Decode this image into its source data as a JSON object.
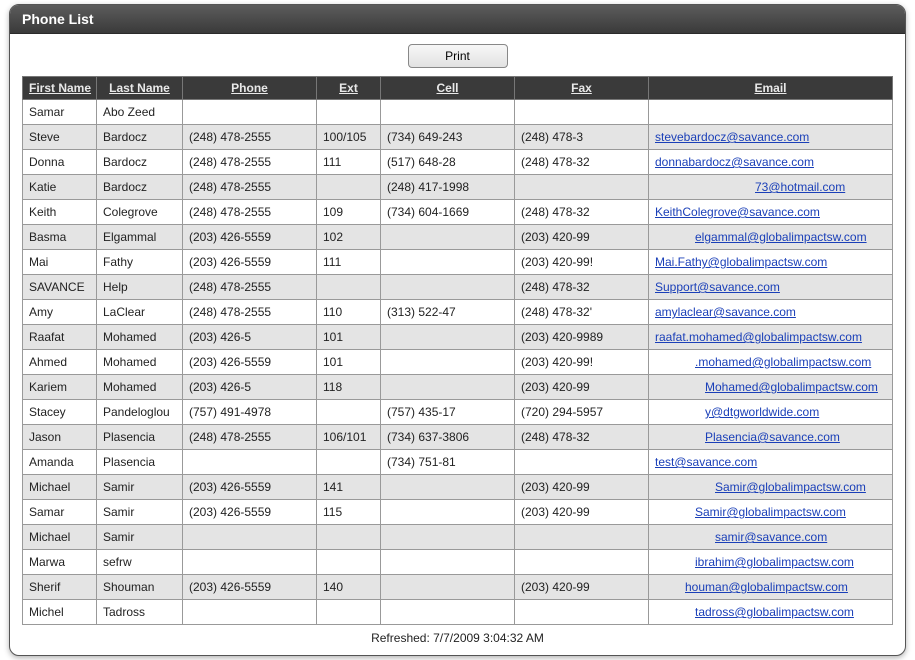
{
  "window": {
    "title": "Phone List"
  },
  "toolbar": {
    "print_label": "Print"
  },
  "columns": {
    "first": "First Name",
    "last": "Last Name",
    "phone": "Phone",
    "ext": "Ext",
    "cell": "Cell",
    "fax": "Fax",
    "email": "Email"
  },
  "footer": {
    "refreshed": "Refreshed: 7/7/2009 3:04:32 AM"
  },
  "rows": [
    {
      "first": "Samar",
      "last": "Abo Zeed",
      "phone": "",
      "ext": "",
      "cell": "",
      "fax": "",
      "email": "",
      "indent": 0
    },
    {
      "first": "Steve",
      "last": "Bardocz",
      "phone": "(248) 478-2555",
      "ext": "100/105",
      "cell": "(734) 649-243",
      "fax": "(248) 478-3",
      "email": "stevebardocz@savance.com",
      "indent": 0
    },
    {
      "first": "Donna",
      "last": "Bardocz",
      "phone": "(248) 478-2555",
      "ext": "111",
      "cell": "(517) 648-28",
      "fax": "(248) 478-32",
      "email": "donnabardocz@savance.com",
      "indent": 0
    },
    {
      "first": "Katie",
      "last": "Bardocz",
      "phone": "(248) 478-2555",
      "ext": "",
      "cell": "(248) 417-1998",
      "fax": "",
      "email": "73@hotmail.com",
      "indent": 100
    },
    {
      "first": "Keith",
      "last": "Colegrove",
      "phone": "(248) 478-2555",
      "ext": "109",
      "cell": "(734) 604-1669",
      "fax": "(248) 478-32",
      "email": "KeithColegrove@savance.com",
      "indent": 0
    },
    {
      "first": "Basma",
      "last": "Elgammal",
      "phone": "(203) 426-5559",
      "ext": "102",
      "cell": "",
      "fax": "(203) 420-99",
      "email": "elgammal@globalimpactsw.com",
      "indent": 40
    },
    {
      "first": "Mai",
      "last": "Fathy",
      "phone": "(203) 426-5559",
      "ext": "111",
      "cell": "",
      "fax": "(203) 420-99!",
      "email": "Mai.Fathy@globalimpactsw.com",
      "indent": 0
    },
    {
      "first": "SAVANCE",
      "last": "Help",
      "phone": "(248) 478-2555",
      "ext": "",
      "cell": "",
      "fax": "(248) 478-32",
      "email": "Support@savance.com",
      "indent": 0
    },
    {
      "first": "Amy",
      "last": "LaClear",
      "phone": "(248) 478-2555",
      "ext": "110",
      "cell": "(313) 522-47",
      "fax": "(248) 478-32'",
      "email": "amylaclear@savance.com",
      "indent": 0
    },
    {
      "first": "Raafat",
      "last": "Mohamed",
      "phone": "(203) 426-5",
      "ext": "101",
      "cell": "",
      "fax": "(203) 420-9989",
      "email": "raafat.mohamed@globalimpactsw.com",
      "indent": 0
    },
    {
      "first": "Ahmed",
      "last": "Mohamed",
      "phone": "(203) 426-5559",
      "ext": "101",
      "cell": "",
      "fax": "(203) 420-99!",
      "email": ".mohamed@globalimpactsw.com",
      "indent": 40
    },
    {
      "first": "Kariem",
      "last": "Mohamed",
      "phone": "(203) 426-5",
      "ext": "118",
      "cell": "",
      "fax": "(203) 420-99",
      "email": "Mohamed@globalimpactsw.com",
      "indent": 50
    },
    {
      "first": "Stacey",
      "last": "Pandeloglou",
      "phone": "(757) 491-4978",
      "ext": "",
      "cell": "(757) 435-17",
      "fax": "(720) 294-5957",
      "email": "y@dtgworldwide.com",
      "indent": 50
    },
    {
      "first": "Jason",
      "last": "Plasencia",
      "phone": "(248) 478-2555",
      "ext": "106/101",
      "cell": "(734) 637-3806",
      "fax": "(248) 478-32",
      "email": "Plasencia@savance.com",
      "indent": 50
    },
    {
      "first": "Amanda",
      "last": "Plasencia",
      "phone": "",
      "ext": "",
      "cell": "(734) 751-81",
      "fax": "",
      "email": "test@savance.com",
      "indent": 0
    },
    {
      "first": "Michael",
      "last": "Samir",
      "phone": "(203) 426-5559",
      "ext": "141",
      "cell": "",
      "fax": "(203) 420-99",
      "email": "Samir@globalimpactsw.com",
      "indent": 60
    },
    {
      "first": "Samar",
      "last": "Samir",
      "phone": "(203) 426-5559",
      "ext": "115",
      "cell": "",
      "fax": "(203) 420-99",
      "email": "Samir@globalimpactsw.com",
      "indent": 40
    },
    {
      "first": "Michael",
      "last": "Samir",
      "phone": "",
      "ext": "",
      "cell": "",
      "fax": "",
      "email": "samir@savance.com",
      "indent": 60
    },
    {
      "first": "Marwa",
      "last": "sefrw",
      "phone": "",
      "ext": "",
      "cell": "",
      "fax": "",
      "email": "ibrahim@globalimpactsw.com",
      "indent": 40
    },
    {
      "first": "Sherif",
      "last": "Shouman",
      "phone": "(203) 426-5559",
      "ext": "140",
      "cell": "",
      "fax": "(203) 420-99",
      "email": "houman@globalimpactsw.com",
      "indent": 30
    },
    {
      "first": "Michel",
      "last": "Tadross",
      "phone": "",
      "ext": "",
      "cell": "",
      "fax": "",
      "email": "tadross@globalimpactsw.com",
      "indent": 40
    }
  ]
}
